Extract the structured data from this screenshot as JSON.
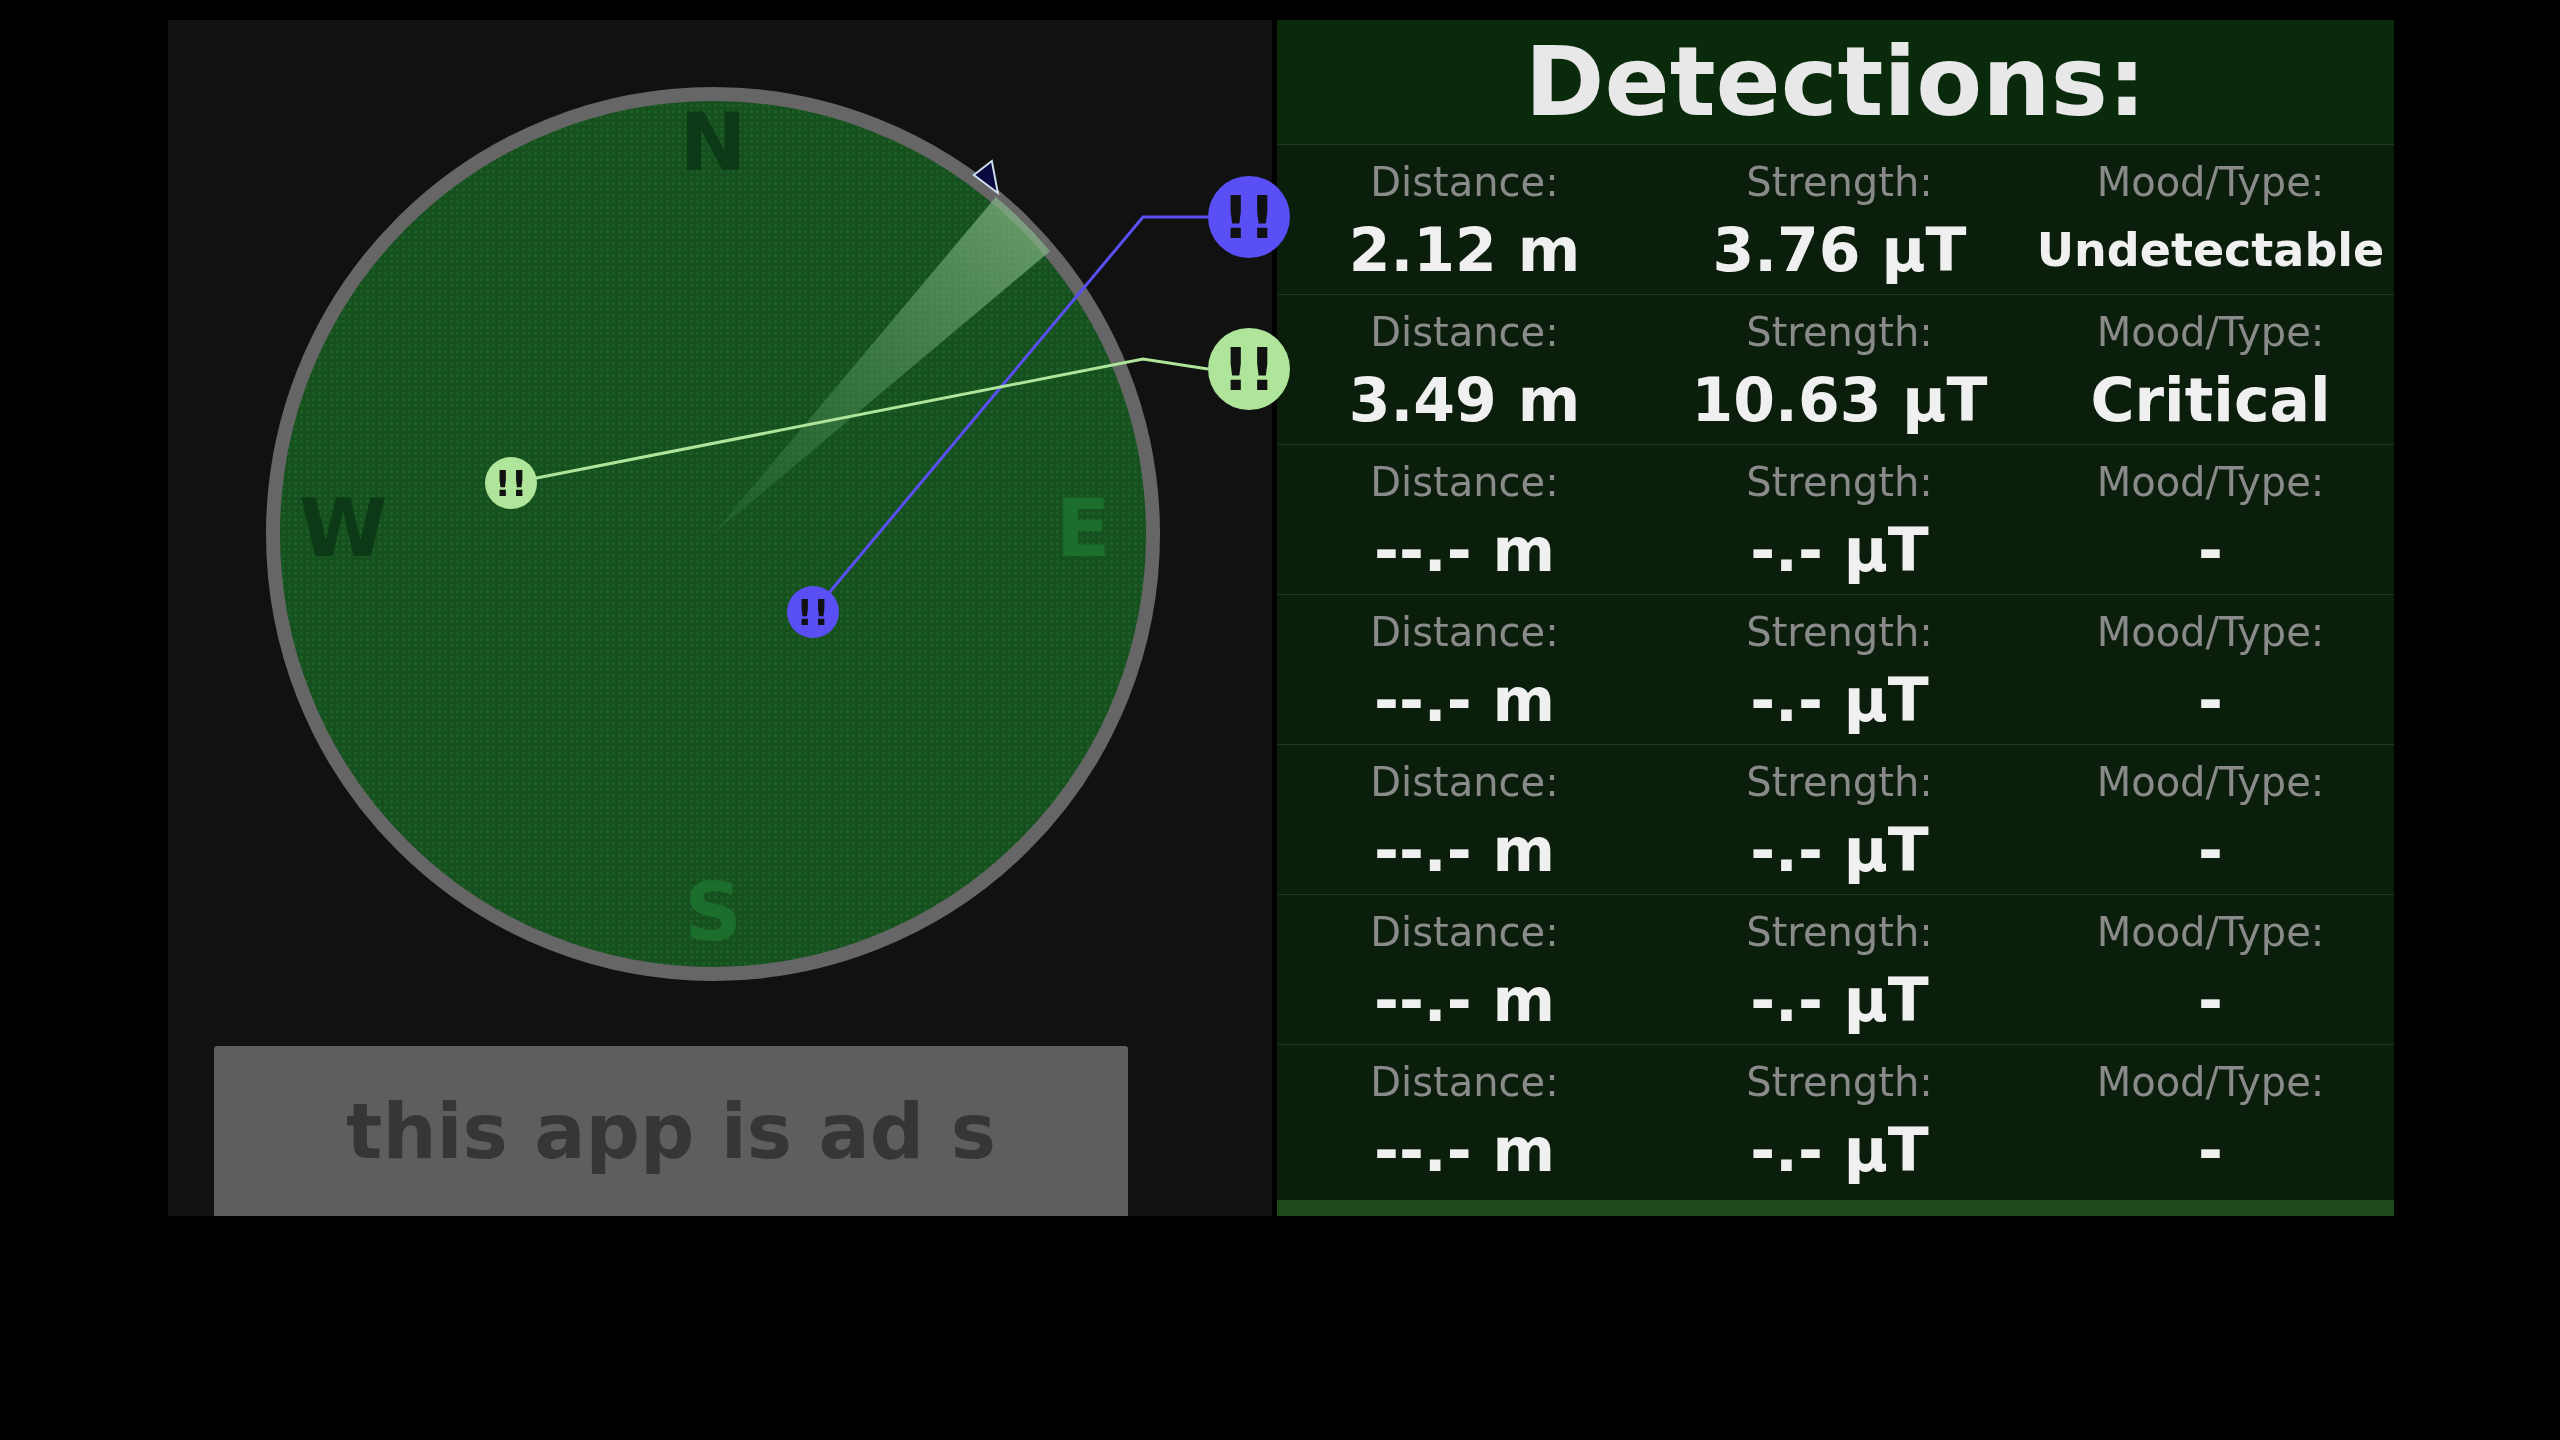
{
  "radar": {
    "compass": [
      {
        "letter": "N",
        "color": "#0d3a16"
      },
      {
        "letter": "W",
        "color": "#0d3a16"
      },
      {
        "letter": "E",
        "color": "#1b6e2c"
      },
      {
        "letter": "S",
        "color": "#1b6e2c"
      }
    ],
    "blips": [
      {
        "mark": "!!",
        "color": "#5a4ff5"
      },
      {
        "mark": "!!",
        "color": "#aee59a"
      }
    ]
  },
  "ad": {
    "text": "this app is ad s"
  },
  "detections": {
    "title": "Detections:",
    "rows": [
      {
        "distance_label": "Distance:",
        "distance": "2.12 m",
        "strength_label": "Strength:",
        "strength": "3.76 µT",
        "mood_label": "Mood/Type:",
        "mood": "Undetectable"
      },
      {
        "distance_label": "Distance:",
        "distance": "3.49 m",
        "strength_label": "Strength:",
        "strength": "10.63 µT",
        "mood_label": "Mood/Type:",
        "mood": "Critical"
      },
      {
        "distance_label": "Distance:",
        "distance": "--.- m",
        "strength_label": "Strength:",
        "strength": "-.- µT",
        "mood_label": "Mood/Type:",
        "mood": "-"
      },
      {
        "distance_label": "Distance:",
        "distance": "--.- m",
        "strength_label": "Strength:",
        "strength": "-.- µT",
        "mood_label": "Mood/Type:",
        "mood": "-"
      },
      {
        "distance_label": "Distance:",
        "distance": "--.- m",
        "strength_label": "Strength:",
        "strength": "-.- µT",
        "mood_label": "Mood/Type:",
        "mood": "-"
      },
      {
        "distance_label": "Distance:",
        "distance": "--.- m",
        "strength_label": "Strength:",
        "strength": "-.- µT",
        "mood_label": "Mood/Type:",
        "mood": "-"
      },
      {
        "distance_label": "Distance:",
        "distance": "--.- m",
        "strength_label": "Strength:",
        "strength": "-.- µT",
        "mood_label": "Mood/Type:",
        "mood": "-"
      }
    ]
  }
}
